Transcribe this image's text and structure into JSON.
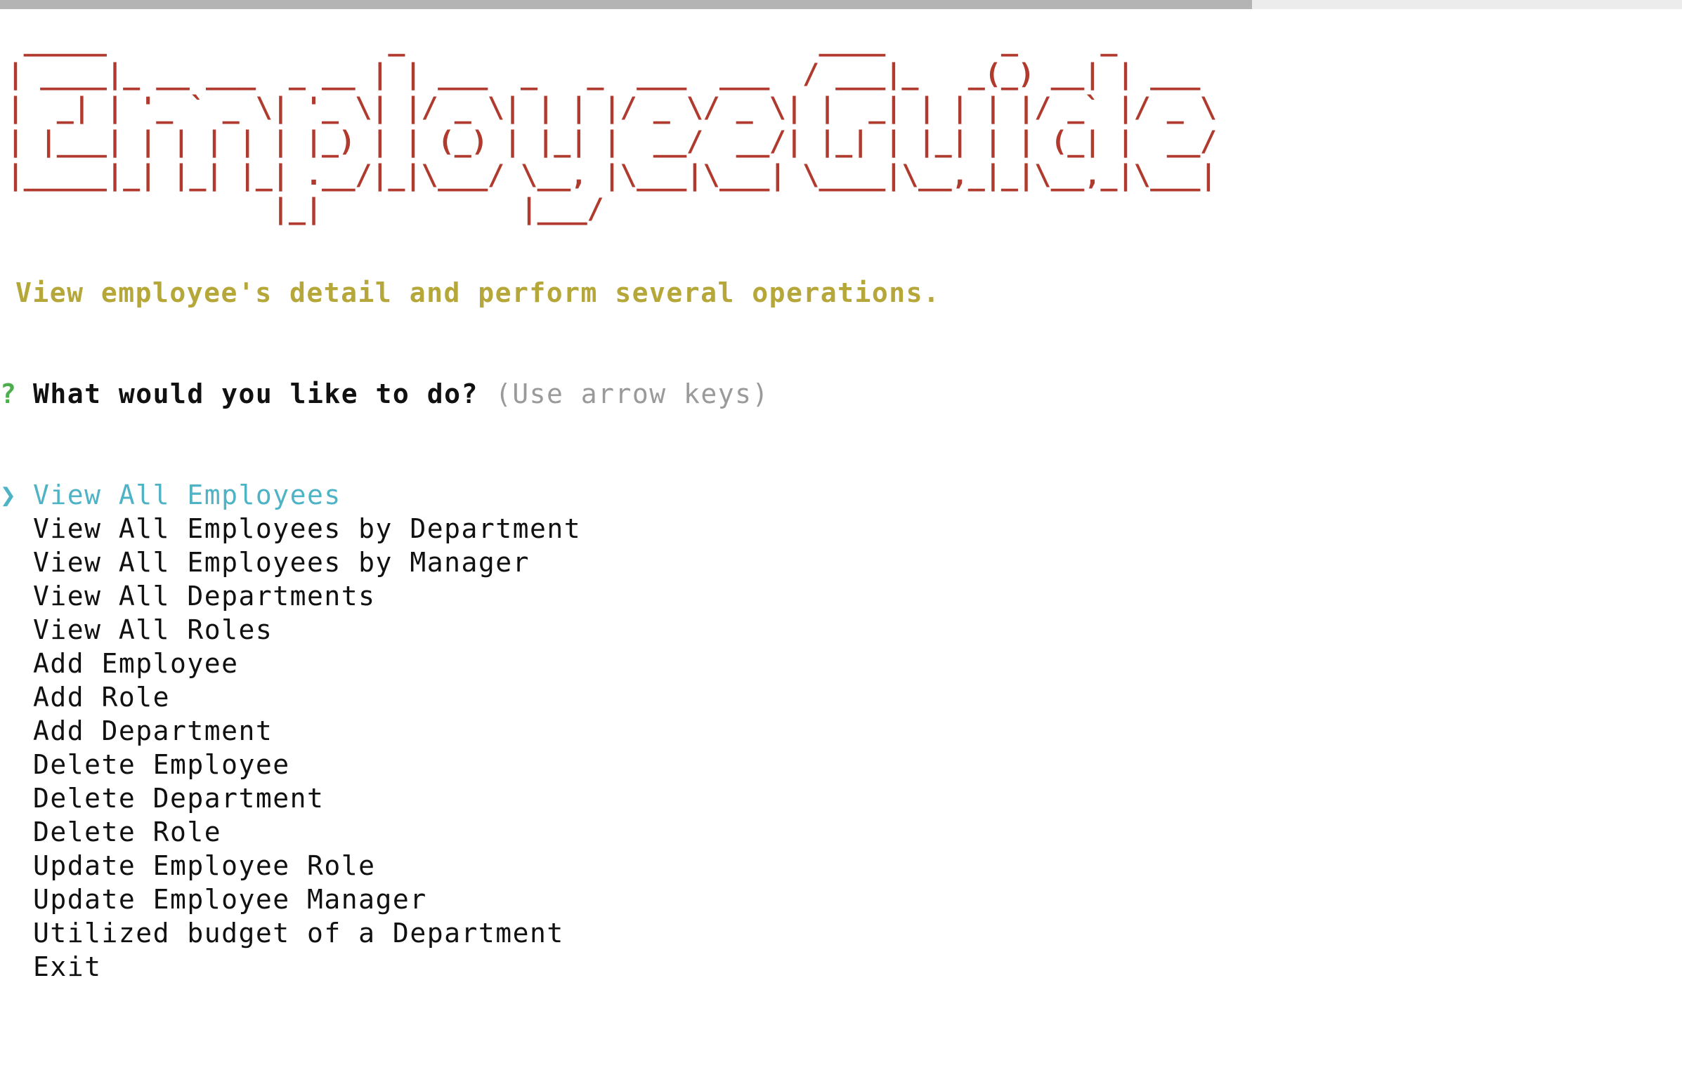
{
  "banner": {
    "title": "Employee Guide",
    "ascii_art": " _____                 _                         ____       _     _\n| ____|_ __ ___  _ __ | | ___  _   _  ___  ___  / ___|_   _(_) __| | ___\n|  _| | '_ ` _ \\| '_ \\| |/ _ \\| | | |/ _ \\/ _ \\| |  _| | | | |/ _` |/ _ \\\n| |___| | | | | | |_) | | (_) | |_| |  __/  __/| |_| | |_| | | (_| |  __/\n|_____|_| |_| |_| .__/|_|\\___/ \\__, |\\___|\\___| \\____|\\__,_|_|\\__,_|\\___|\n                |_|            |___/"
  },
  "tagline": "View employee's detail and perform several operations.",
  "prompt": {
    "question_mark": "?",
    "question": "What would you like to do?",
    "hint": "(Use arrow keys)",
    "pointer": "❯"
  },
  "choices": [
    "View All Employees",
    "View All Employees by Department",
    "View All Employees by Manager",
    "View All Departments",
    "View All Roles",
    "Add Employee",
    "Add Role",
    "Add Department",
    "Delete Employee",
    "Delete Department",
    "Delete Role",
    "Update Employee Role",
    "Update Employee Manager",
    "Utilized budget of a Department",
    "Exit"
  ],
  "selected_index": 0,
  "colors": {
    "banner": "#b03a2e",
    "tagline": "#b5a73a",
    "question_mark": "#4cae4c",
    "selected": "#4fb3c6",
    "hint": "#9a9a9a"
  }
}
